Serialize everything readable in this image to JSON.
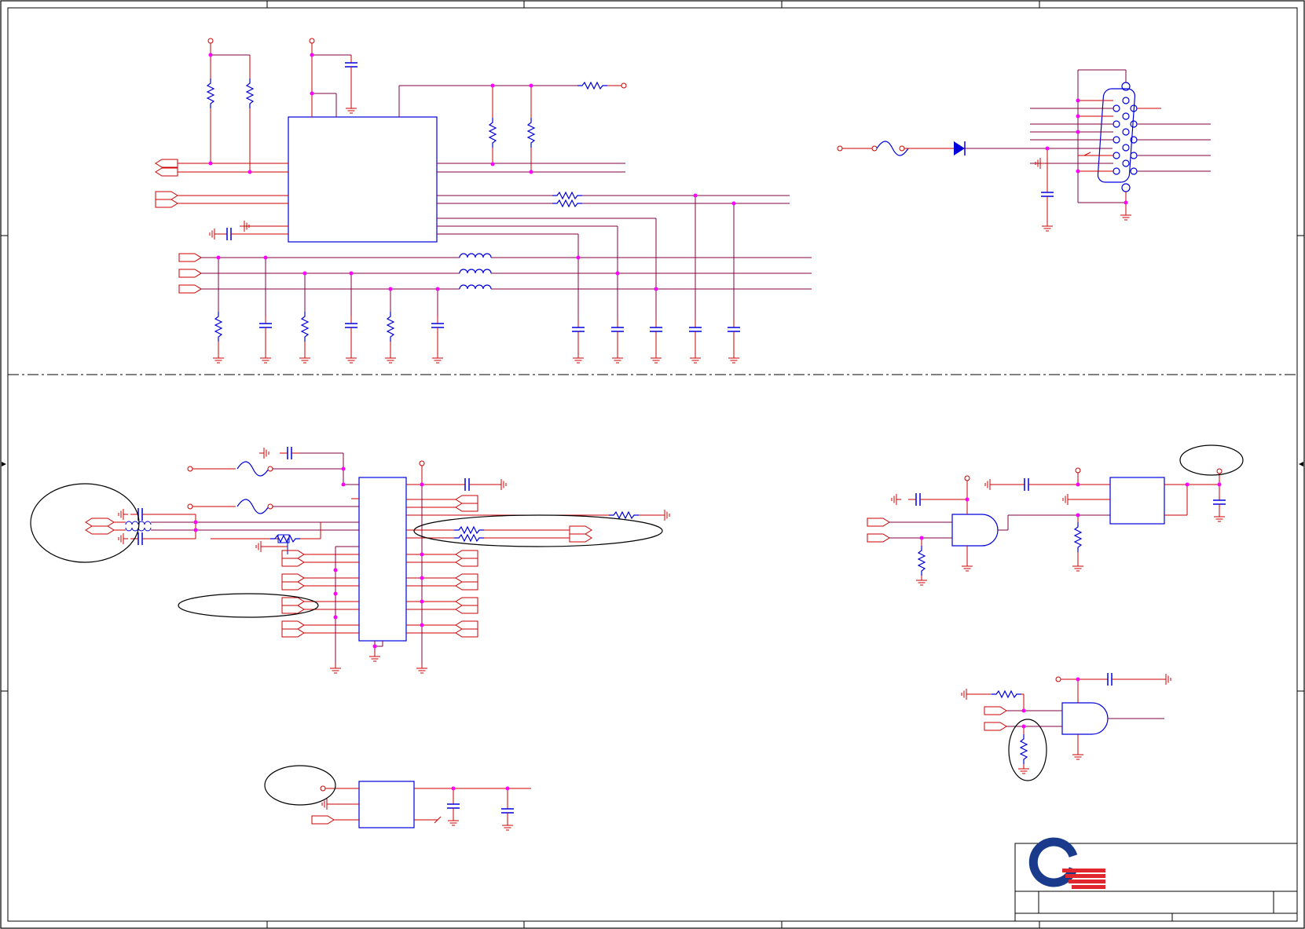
{
  "sheet": {
    "title": "",
    "zones": {
      "columns": [],
      "rows": []
    },
    "title_block": {
      "company_logo": "quanta-logo",
      "fields": []
    }
  },
  "colors": {
    "wire": "#cc0000",
    "net": "#800040",
    "component": "#0000dd",
    "junction": "#ff00ff",
    "frame": "#000000",
    "logo_blue": "#1a3a8c",
    "logo_red": "#e0262e"
  },
  "sections": [
    "top-left-vga-dac-circuit",
    "top-right-db15-connector",
    "bottom-left-tv-encoder-ic",
    "bottom-left-regulator",
    "bottom-right-logic-gates"
  ],
  "annotations": {
    "circled_regions": 6
  }
}
